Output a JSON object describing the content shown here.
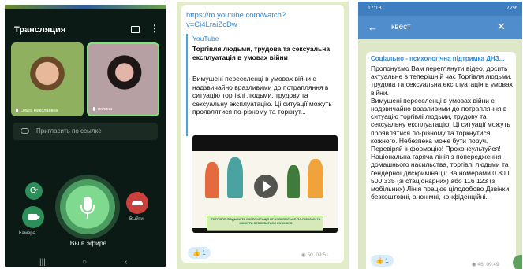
{
  "call": {
    "title": "Трансляция",
    "participants": [
      {
        "name": "Ольга Николаевна"
      },
      {
        "name": "полина"
      }
    ],
    "invite_label": "Пригласить по ссылке",
    "camera_label": "Камера",
    "leave_label": "Выйти",
    "live_label": "Вы в эфире"
  },
  "youtube_post": {
    "link": "https://m.youtube.com/watch?v=Ci4LraiZcDw",
    "source": "YouTube",
    "title": "Торгівля людьми, трудова та сексуальна експлуатація в умовах війни",
    "description": "Вимушені переселенці в умовах війни є надзвичайно вразливими до потрапляння в ситуацію торгівлі людьми, трудову та сексуальну експлуатацію. Ці ситуації можуть проявлятися по-різному та торкнут...",
    "thumbnail_caption": "ТОРГІВЛЯ ЛЮДЬМИ ТА ЕКСПЛУАТАЦІЯ ПРОЯВЛЯЮТЬСЯ ПО-РІЗНОМУ ТА МОЖУТЬ СТОСУВАТИСЯ КОЖНОГО",
    "reaction_count": "1",
    "views": "50",
    "time": "09:51"
  },
  "search_chat": {
    "status_time": "17:18",
    "battery": "72%",
    "query": "квест",
    "sender": "Соціально - психологічна підтримка ДНЗ...",
    "body": "Пропонуємо Вам переглянути відео, досить актуальне в теперішній час Торгівля людьми, трудова та сексуальна експлуатація в умовах війни.\nВимушені переселенці в умовах війни є надзвичайно вразливими до потрапляння в ситуацію торгівлі людьми, трудову та сексуальну експлуатацію. Ці ситуації можуть проявлятися по-різному та торкнутися кожного.  Небезпека може бути поруч. Перевіряй інформацію! Проконсультуйся!\nНаціональна гаряча лінія з попередження домашнього насильства, торгівлі людьми та ґендерної дискримінації: За номерами 0 800 500 335 (зі стаціонарних) або 116 123 (з мобільних)  Лінія працює цілодобово Дзвінки безкоштовні, анонімні, конфіденційні.",
    "reaction_count": "1",
    "views": "46",
    "time": "09:49"
  },
  "colors": {
    "call_bg": "#0b1a14",
    "accent_green": "#7ee37a",
    "end_call": "#c9413c",
    "telegram_header": "#4f8dcc",
    "link": "#2f8ad8",
    "chat_bg": "#e3ecc9"
  },
  "icons": [
    "cast-icon",
    "more-icon",
    "link-icon",
    "flip-camera-icon",
    "camera-icon",
    "microphone-icon",
    "end-call-icon",
    "back-icon",
    "close-icon",
    "thumbs-up-icon",
    "eye-icon",
    "play-icon"
  ]
}
